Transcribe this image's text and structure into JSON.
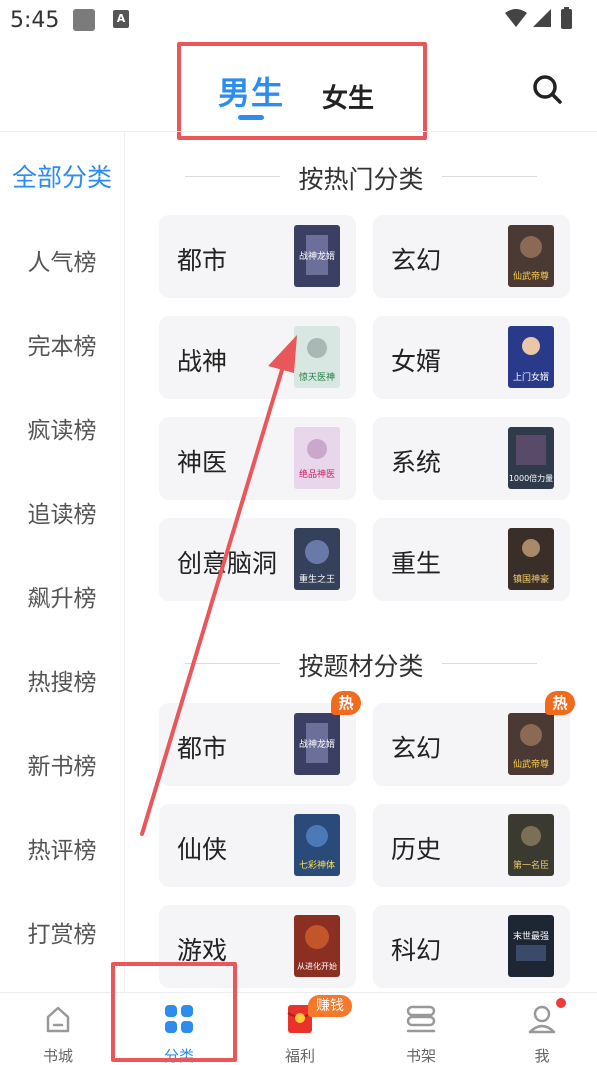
{
  "status_bar": {
    "time": "5:45",
    "notif_glyph": "A"
  },
  "header": {
    "tabs": [
      {
        "label": "男生",
        "active": true
      },
      {
        "label": "女生",
        "active": false
      }
    ],
    "search_icon": "search-icon"
  },
  "sidebar": {
    "items": [
      {
        "label": "全部分类",
        "active": true
      },
      {
        "label": "人气榜"
      },
      {
        "label": "完本榜"
      },
      {
        "label": "疯读榜"
      },
      {
        "label": "追读榜"
      },
      {
        "label": "飙升榜"
      },
      {
        "label": "热搜榜"
      },
      {
        "label": "新书榜"
      },
      {
        "label": "热评榜"
      },
      {
        "label": "打赏榜"
      }
    ]
  },
  "sections": [
    {
      "title": "按热门分类",
      "categories": [
        {
          "label": "都市",
          "cover_text": "战神龙婿",
          "cover_color": "#3a3f63"
        },
        {
          "label": "玄幻",
          "cover_text": "仙武帝尊",
          "cover_color": "#4a3a33"
        },
        {
          "label": "战神",
          "cover_text": "惊天医神",
          "cover_color": "#d9e7e3"
        },
        {
          "label": "女婿",
          "cover_text": "上门女婿",
          "cover_color": "#2a3a8a"
        },
        {
          "label": "神医",
          "cover_text": "绝品神医",
          "cover_color": "#e8d6ea"
        },
        {
          "label": "系统",
          "cover_text": "1000倍力量",
          "cover_color": "#2f3a4a"
        },
        {
          "label": "创意脑洞",
          "cover_text": "重生之王",
          "cover_color": "#35405a"
        },
        {
          "label": "重生",
          "cover_text": "镇国神豪",
          "cover_color": "#3a2f28"
        }
      ]
    },
    {
      "title": "按题材分类",
      "categories": [
        {
          "label": "都市",
          "cover_text": "战神龙婿",
          "cover_color": "#3a3f63",
          "badge": "热"
        },
        {
          "label": "玄幻",
          "cover_text": "仙武帝尊",
          "cover_color": "#4a3a33",
          "badge": "热"
        },
        {
          "label": "仙侠",
          "cover_text": "七彩神体",
          "cover_color": "#2a4a7a"
        },
        {
          "label": "历史",
          "cover_text": "第一名臣",
          "cover_color": "#3a3a30"
        },
        {
          "label": "游戏",
          "cover_text": "从进化开始",
          "cover_color": "#8a2f22"
        },
        {
          "label": "科幻",
          "cover_text": "末世最强",
          "cover_color": "#1f2633"
        }
      ]
    }
  ],
  "bottom_nav": {
    "items": [
      {
        "label": "书城",
        "icon": "bookstore-icon",
        "active": false
      },
      {
        "label": "分类",
        "icon": "category-grid-icon",
        "active": true
      },
      {
        "label": "福利",
        "icon": "red-envelope-icon",
        "active": false,
        "badge": "赚钱"
      },
      {
        "label": "书架",
        "icon": "bookshelf-icon",
        "active": false
      },
      {
        "label": "我",
        "icon": "profile-icon",
        "active": false,
        "dot": true
      }
    ]
  },
  "colors": {
    "accent": "#2d8cf0",
    "hot_badge": "#f26b1d",
    "annotation": "#e9575a",
    "card_bg": "#f5f5f7"
  }
}
